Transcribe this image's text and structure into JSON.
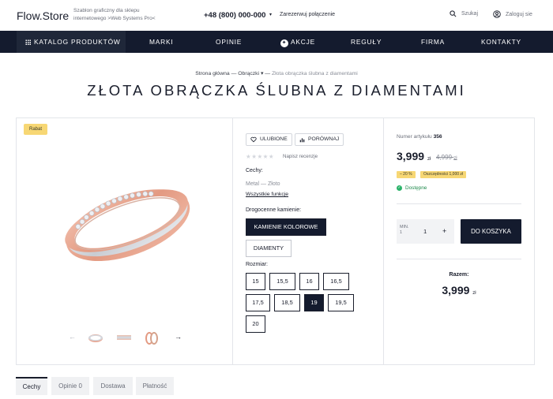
{
  "header": {
    "logo": "Flow.Store",
    "tagline_line1": "Szablon graficzny dla sklepu",
    "tagline_line2": "internetowego >Web Systems Pro<",
    "phone": "+48 (800) 000-000",
    "phone_caret": "▾",
    "callback": "Zarezerwuj połączenie",
    "search_label": "Szukaj",
    "login_label": "Zaloguj sie"
  },
  "nav": {
    "catalog": "KATALOG PRODUKTÓW",
    "items": [
      "MARKI",
      "OPINIE",
      "AKCJE",
      "REGUŁY",
      "FIRMA",
      "KONTAKTY"
    ],
    "akcje_icon": "✦"
  },
  "breadcrumb": {
    "home": "Strona główna",
    "sep1": "—",
    "category": "Obrączki",
    "caret": "▾",
    "sep2": "—",
    "current": "Złota obrączka ślubna z diamentami"
  },
  "product": {
    "title": "ZŁOTA OBRĄCZKA ŚLUBNA Z DIAMENTAMI",
    "badge": "Rabat",
    "thumb_prev": "←",
    "thumb_next": "→"
  },
  "actions": {
    "favorite": "ULUBIONE",
    "compare": "PORÓWNAJ",
    "stars": "★★★★★",
    "review": "Napisz recenzje"
  },
  "features": {
    "heading": "Cechy:",
    "metal": "Metal — Złoto",
    "all_link": "Wszystkie funkcje"
  },
  "stones": {
    "heading": "Drogocenne kamienie:",
    "options": [
      "KAMIENIE KOLOROWE",
      "DIAMENTY"
    ],
    "selected": "KAMIENIE KOLOROWE"
  },
  "sizes": {
    "heading": "Rozmiar:",
    "row1": [
      "15",
      "15,5",
      "16",
      "16,5"
    ],
    "row2": [
      "17,5",
      "18,5",
      "19",
      "19,5"
    ],
    "row3": [
      "20"
    ],
    "selected": "19"
  },
  "purchase": {
    "article_label": "Numer artykułu",
    "article_no": "356",
    "price": "3,999",
    "currency": "zł",
    "old_price": "4,999",
    "discount": "– 20 %",
    "savings": "Oszczędności 1,000 zł",
    "availability": "Dostępne",
    "qty_min_label": "MIN.",
    "qty_min_value": "1",
    "qty": "1",
    "qty_plus": "+",
    "cart_button": "DO KOSZYKA",
    "total_label": "Razem:",
    "total": "3,999"
  },
  "tabs": [
    "Cechy",
    "Opinie 0",
    "Dostawa",
    "Płatność"
  ],
  "colors": {
    "nav_bg": "#141b2e",
    "badge_yellow": "#f7d774",
    "available_green": "#2bb36a",
    "rose_gold": "#e8a08a",
    "white_gold": "#dadde2"
  }
}
